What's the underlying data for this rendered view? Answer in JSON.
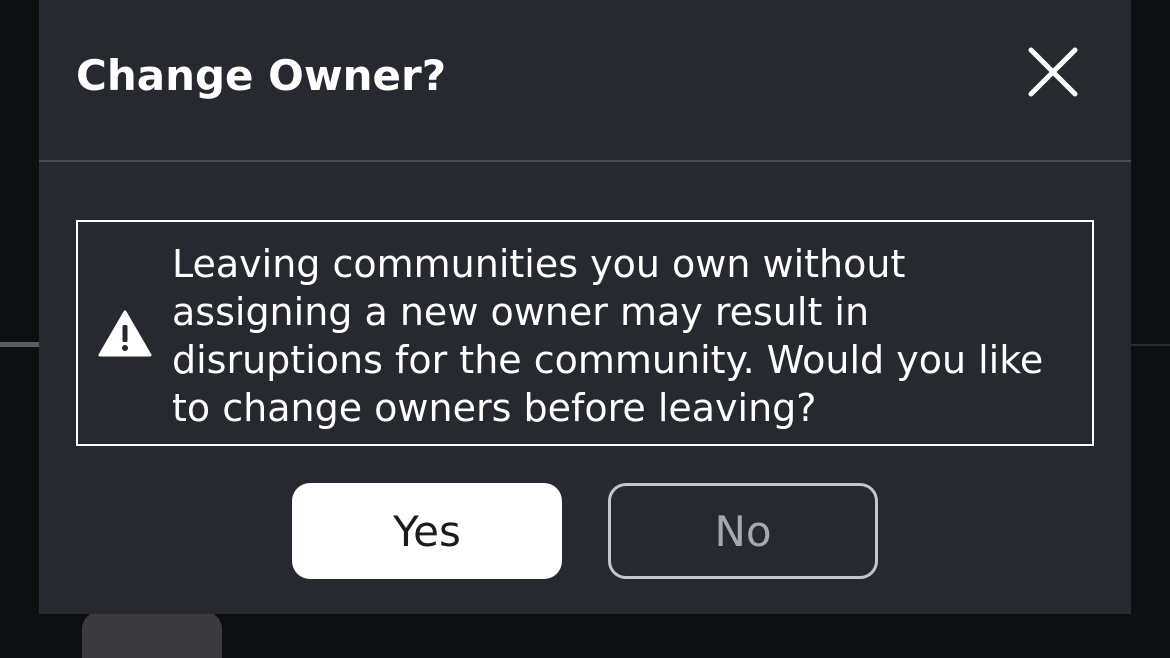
{
  "dialog": {
    "title": "Change Owner?",
    "close_icon": "close-icon",
    "warning": {
      "icon": "warning-triangle-icon",
      "message": "Leaving communities you own without assigning a new owner may result in disruptions for the community. Would you like to change owners before leaving?"
    },
    "buttons": {
      "yes_label": "Yes",
      "no_label": "No"
    }
  },
  "colors": {
    "dialog_background": "#272930",
    "page_background": "#0e0f11",
    "primary_button": "#ffffff",
    "secondary_button_border": "#c4c6cb",
    "divider": "#4a4d55"
  }
}
